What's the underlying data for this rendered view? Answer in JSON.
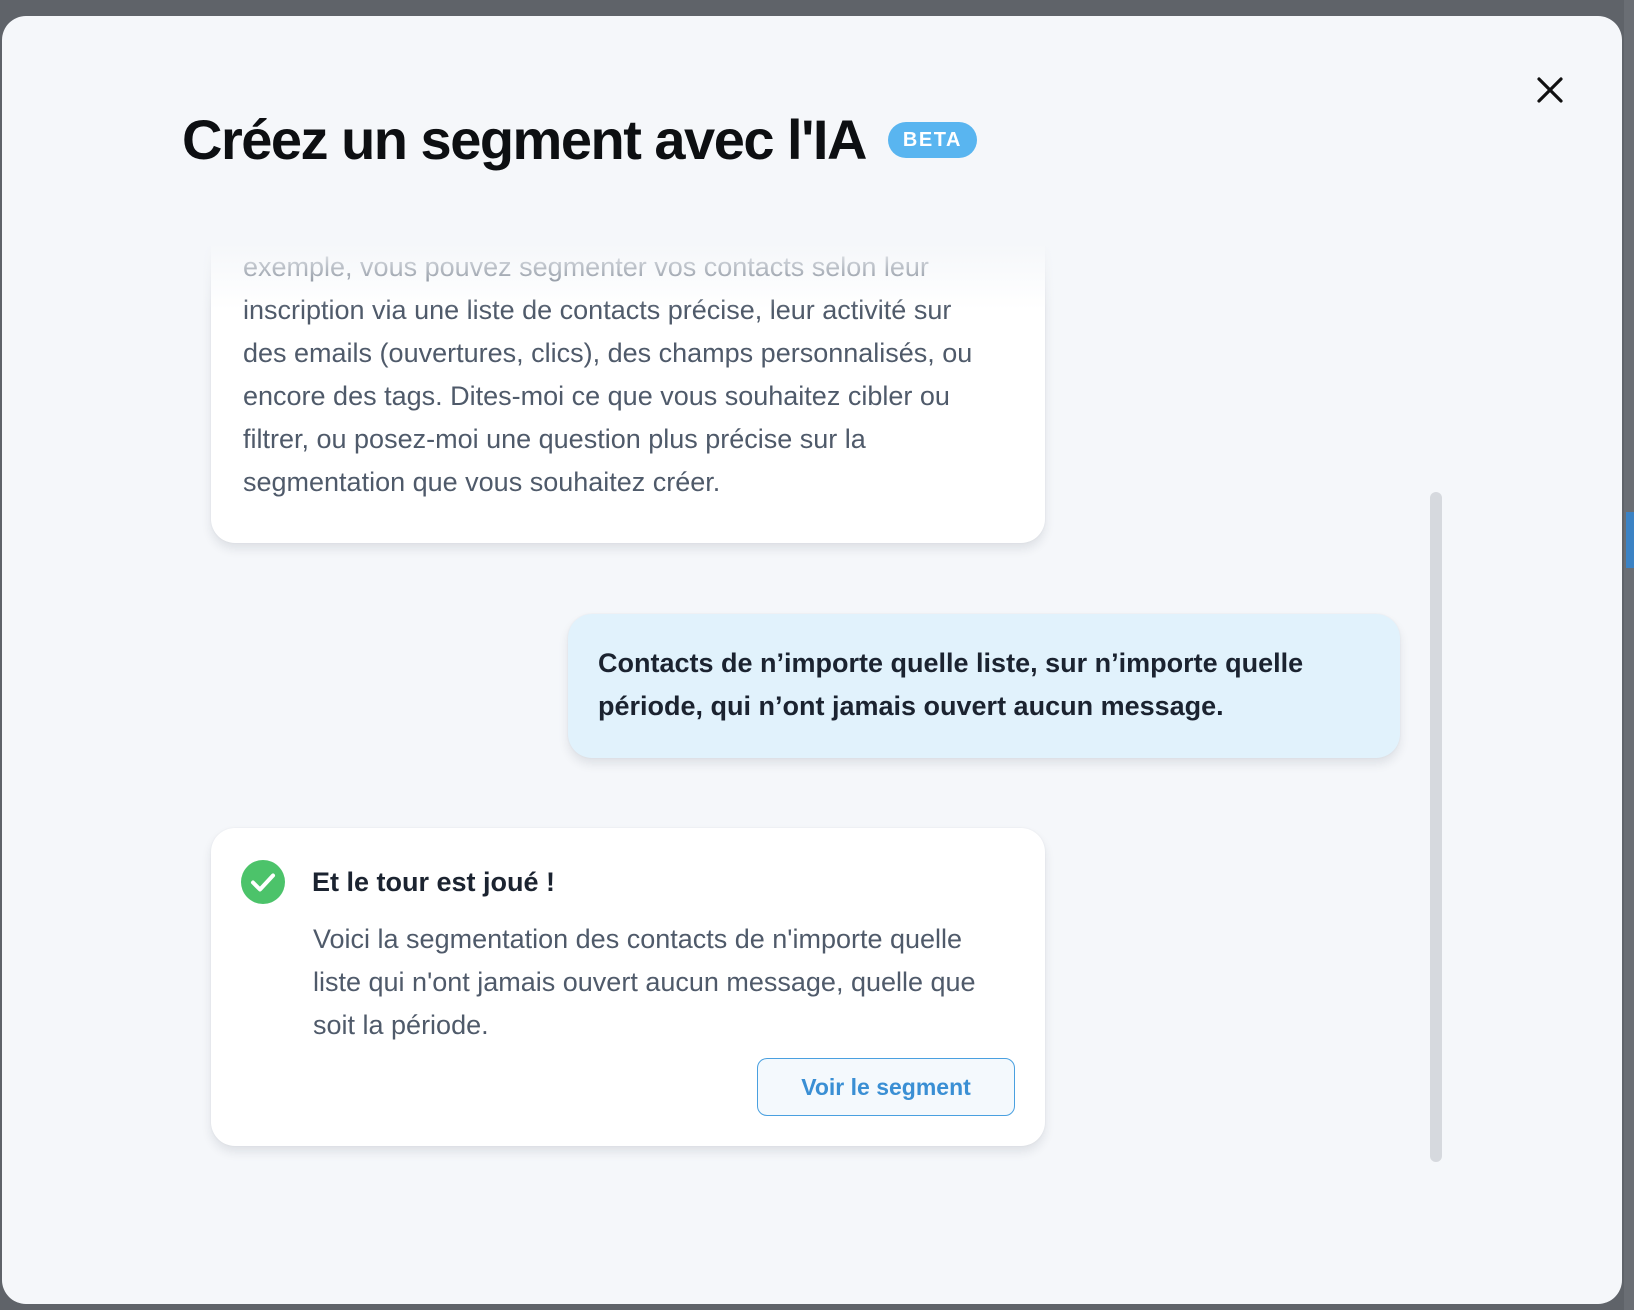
{
  "modal": {
    "title": "Créez un segment avec l'IA",
    "badge": "BETA",
    "close_icon": "close-icon"
  },
  "chat": {
    "messages": [
      {
        "role": "assistant",
        "lines": [
          "exemple, vous pouvez segmenter vos contacts selon leur",
          "inscription via une liste de contacts précise, leur activité sur",
          "des emails (ouvertures, clics), des champs personnalisés, ou",
          "encore des tags. Dites-moi ce que vous souhaitez cibler ou",
          "filtrer, ou posez-moi une question plus précise sur la",
          "segmentation que vous souhaitez créer."
        ]
      },
      {
        "role": "user",
        "lines": [
          "Contacts de n’importe quelle liste, sur n’importe quelle",
          "période, qui n’ont jamais ouvert aucun message."
        ]
      },
      {
        "role": "assistant",
        "status_icon": "check-circle-icon",
        "title": "Et le tour est joué !",
        "lines": [
          "Voici la segmentation des contacts de n'importe quelle",
          "liste qui n'ont jamais ouvert aucun message, quelle que",
          "soit la période."
        ],
        "action_label": "Voir le segment"
      }
    ]
  },
  "colors": {
    "badge": "#59b5f0",
    "user_bubble": "#e1f2fc",
    "success": "#4cc36a",
    "action": "#3a8fd4"
  }
}
